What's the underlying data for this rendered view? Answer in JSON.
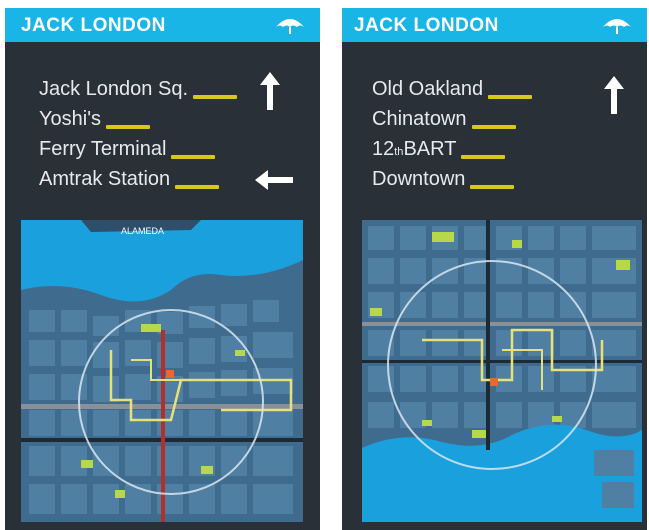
{
  "panels": [
    {
      "brand": "JACK LONDON",
      "destinations": [
        {
          "name": "Jack London Sq.",
          "arrow": "up"
        },
        {
          "name": "Yoshi's",
          "arrow": ""
        },
        {
          "name": "Ferry Terminal",
          "arrow": ""
        },
        {
          "name": "Amtrak Station",
          "arrow": "left"
        }
      ],
      "map_label": "ALAMEDA"
    },
    {
      "brand": "JACK LONDON",
      "destinations": [
        {
          "name": "Old Oakland",
          "arrow": "up"
        },
        {
          "name": "Chinatown",
          "arrow": ""
        },
        {
          "name": "12",
          "sup": "th",
          "rest": " BART",
          "arrow": ""
        },
        {
          "name": "Downtown",
          "arrow": ""
        }
      ]
    }
  ],
  "colors": {
    "panel_bg": "#2a3038",
    "header": "#19b5e6",
    "water": "#1aa0dc",
    "land": "#3f6c8e",
    "block": "#4f7fa2",
    "street": "#1c2a36",
    "highlight_green": "#b7d84a",
    "route_yellow": "#e8e07a",
    "tag_yellow": "#d8c81a"
  },
  "icons": [
    "umbrella-logo-icon",
    "arrow-up-icon",
    "arrow-left-icon",
    "you-are-here-icon"
  ]
}
